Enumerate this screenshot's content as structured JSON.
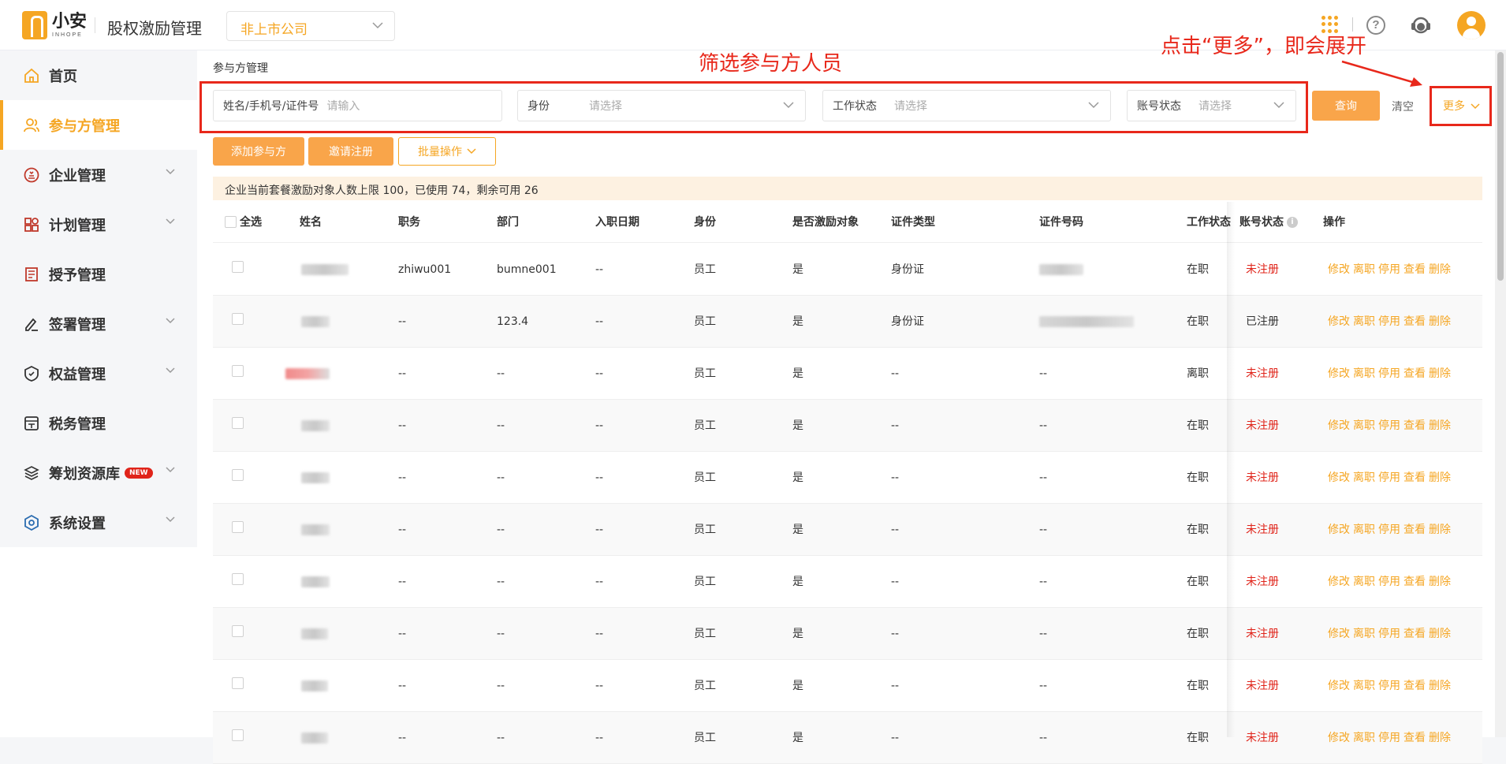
{
  "app": {
    "logo_cn": "小安",
    "logo_en": "INHOPE",
    "title": "股权激励管理",
    "company_select": "非上市公司"
  },
  "header_icons": {
    "apps": "apps-grid-icon",
    "help": "?",
    "service": "customer-service-icon",
    "user": "user-avatar-icon"
  },
  "sidebar": {
    "items": [
      {
        "label": "首页",
        "icon": "home-icon",
        "has_children": false,
        "active": false
      },
      {
        "label": "参与方管理",
        "icon": "users-icon",
        "has_children": false,
        "active": true
      },
      {
        "label": "企业管理",
        "icon": "enterprise-icon",
        "has_children": true,
        "active": false
      },
      {
        "label": "计划管理",
        "icon": "plan-icon",
        "has_children": true,
        "active": false
      },
      {
        "label": "授予管理",
        "icon": "grant-icon",
        "has_children": false,
        "active": false
      },
      {
        "label": "签署管理",
        "icon": "sign-icon",
        "has_children": true,
        "active": false
      },
      {
        "label": "权益管理",
        "icon": "equity-icon",
        "has_children": true,
        "active": false
      },
      {
        "label": "税务管理",
        "icon": "tax-icon",
        "has_children": false,
        "active": false
      },
      {
        "label": "筹划资源库",
        "icon": "layers-icon",
        "has_children": true,
        "active": false,
        "badge": "NEW"
      },
      {
        "label": "系统设置",
        "icon": "settings-icon",
        "has_children": true,
        "active": false
      }
    ]
  },
  "page": {
    "breadcrumb": "参与方管理",
    "annotation_filter": "筛选参与方人员",
    "annotation_more": "点击“更多”，即会展开"
  },
  "filters": {
    "name": {
      "label": "姓名/手机号/证件号",
      "placeholder": "请输入"
    },
    "identity": {
      "label": "身份",
      "placeholder": "请选择"
    },
    "work_status": {
      "label": "工作状态",
      "placeholder": "请选择"
    },
    "account_status": {
      "label": "账号状态",
      "placeholder": "请选择"
    },
    "query": "查询",
    "clear": "清空",
    "more": "更多"
  },
  "actions": {
    "add": "添加参与方",
    "invite": "邀请注册",
    "batch": "批量操作"
  },
  "notice": "企业当前套餐激励对象人数上限 100，已使用 74，剩余可用 26",
  "table": {
    "columns": [
      "全选",
      "姓名",
      "职务",
      "部门",
      "入职日期",
      "身份",
      "是否激励对象",
      "证件类型",
      "证件号码",
      "工作状态",
      "账号状态",
      "操作"
    ],
    "ops": [
      "修改",
      "离职",
      "停用",
      "查看",
      "删除"
    ],
    "rows": [
      {
        "position": "zhiwu001",
        "dept": "bumne001",
        "date": "--",
        "identity": "员工",
        "incentive": "是",
        "id_type": "身份证",
        "id_no": "",
        "work": "在职",
        "account": "未注册"
      },
      {
        "position": "--",
        "dept": "123.4",
        "date": "--",
        "identity": "员工",
        "incentive": "是",
        "id_type": "身份证",
        "id_no": "",
        "work": "在职",
        "account": "已注册"
      },
      {
        "position": "--",
        "dept": "--",
        "date": "--",
        "identity": "员工",
        "incentive": "是",
        "id_type": "--",
        "id_no": "--",
        "work": "离职",
        "account": "未注册"
      },
      {
        "position": "--",
        "dept": "--",
        "date": "--",
        "identity": "员工",
        "incentive": "是",
        "id_type": "--",
        "id_no": "--",
        "work": "在职",
        "account": "未注册"
      },
      {
        "position": "--",
        "dept": "--",
        "date": "--",
        "identity": "员工",
        "incentive": "是",
        "id_type": "--",
        "id_no": "--",
        "work": "在职",
        "account": "未注册"
      },
      {
        "position": "--",
        "dept": "--",
        "date": "--",
        "identity": "员工",
        "incentive": "是",
        "id_type": "--",
        "id_no": "--",
        "work": "在职",
        "account": "未注册"
      },
      {
        "position": "--",
        "dept": "--",
        "date": "--",
        "identity": "员工",
        "incentive": "是",
        "id_type": "--",
        "id_no": "--",
        "work": "在职",
        "account": "未注册"
      },
      {
        "position": "--",
        "dept": "--",
        "date": "--",
        "identity": "员工",
        "incentive": "是",
        "id_type": "--",
        "id_no": "--",
        "work": "在职",
        "account": "未注册"
      },
      {
        "position": "--",
        "dept": "--",
        "date": "--",
        "identity": "员工",
        "incentive": "是",
        "id_type": "--",
        "id_no": "--",
        "work": "在职",
        "account": "未注册"
      },
      {
        "position": "--",
        "dept": "--",
        "date": "--",
        "identity": "员工",
        "incentive": "是",
        "id_type": "--",
        "id_no": "--",
        "work": "在职",
        "account": "未注册"
      }
    ]
  },
  "colors": {
    "accent": "#f5a623",
    "primary_button": "#f9a54a",
    "danger": "#e0241a",
    "annotation": "#e8281b"
  }
}
